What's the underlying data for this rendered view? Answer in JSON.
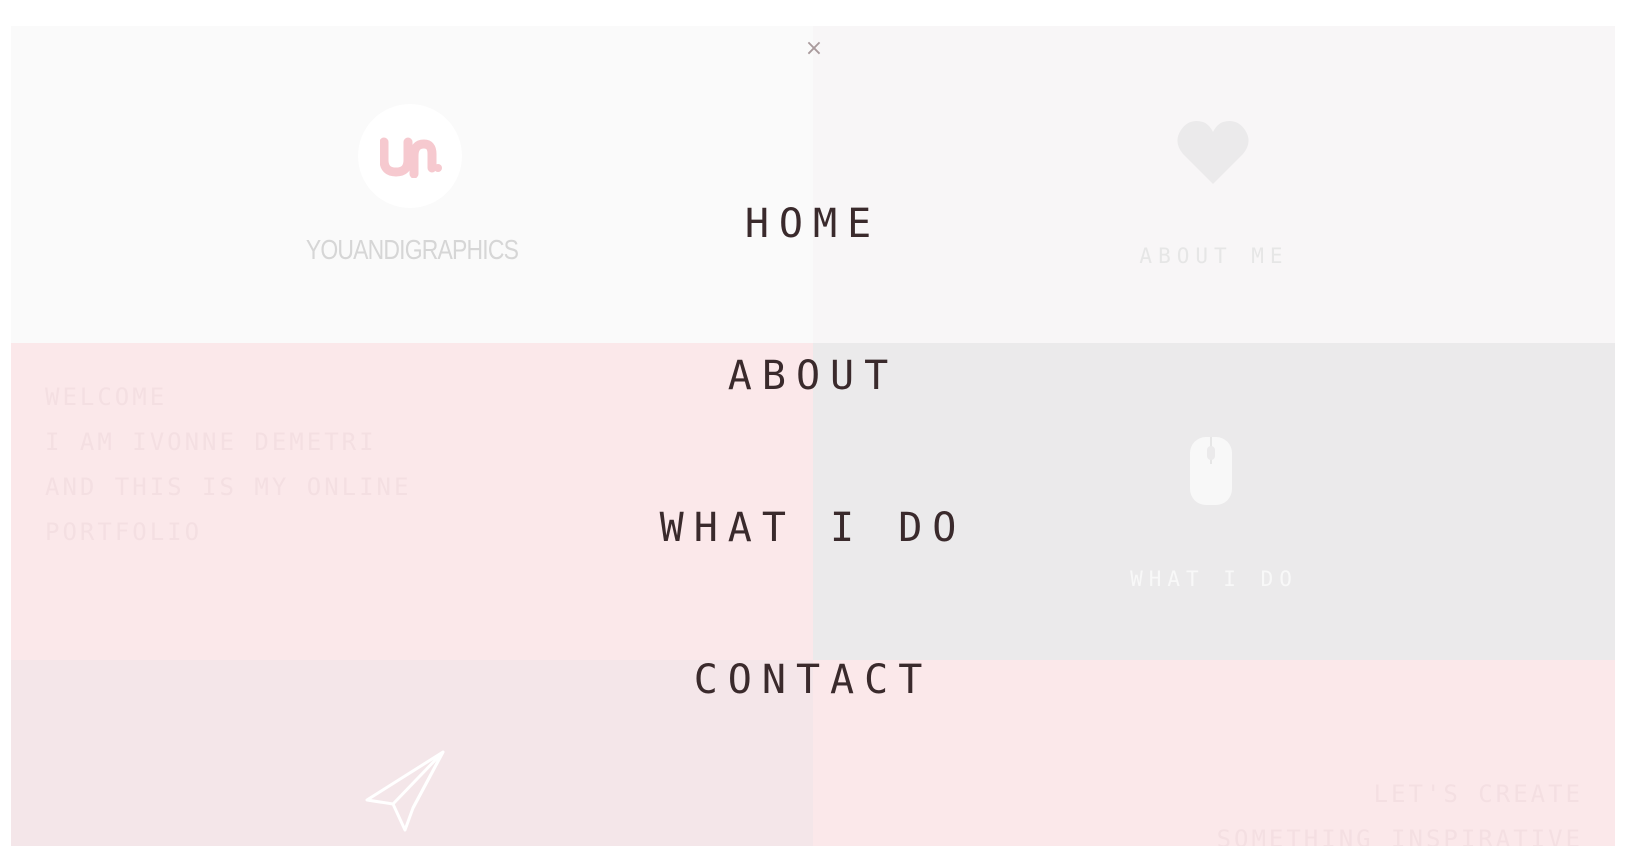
{
  "close_icon": "×",
  "nav": {
    "home": "HOME",
    "about": "ABOUT",
    "what_i_do": "WHAT I DO",
    "contact": "CONTACT"
  },
  "tiles": {
    "brand": {
      "name": "YOUANDIGRAPHICS",
      "logo_icon": "logo-icon"
    },
    "about": {
      "label": "ABOUT ME",
      "icon": "heart-icon"
    },
    "welcome": {
      "text": "WELCOME\nI AM IVONNE DEMETRI\nAND THIS IS MY ONLINE\nPORTFOLIO"
    },
    "what_i_do": {
      "label": "WHAT I DO",
      "icon": "mouse-icon"
    },
    "contact": {
      "icon": "paper-plane-icon"
    },
    "inspire": {
      "text": "LET'S CREATE\nSOMETHING INSPIRATIVE"
    }
  },
  "colors": {
    "accent": "#f6c9cf",
    "nav_text": "#3a2a2c"
  }
}
